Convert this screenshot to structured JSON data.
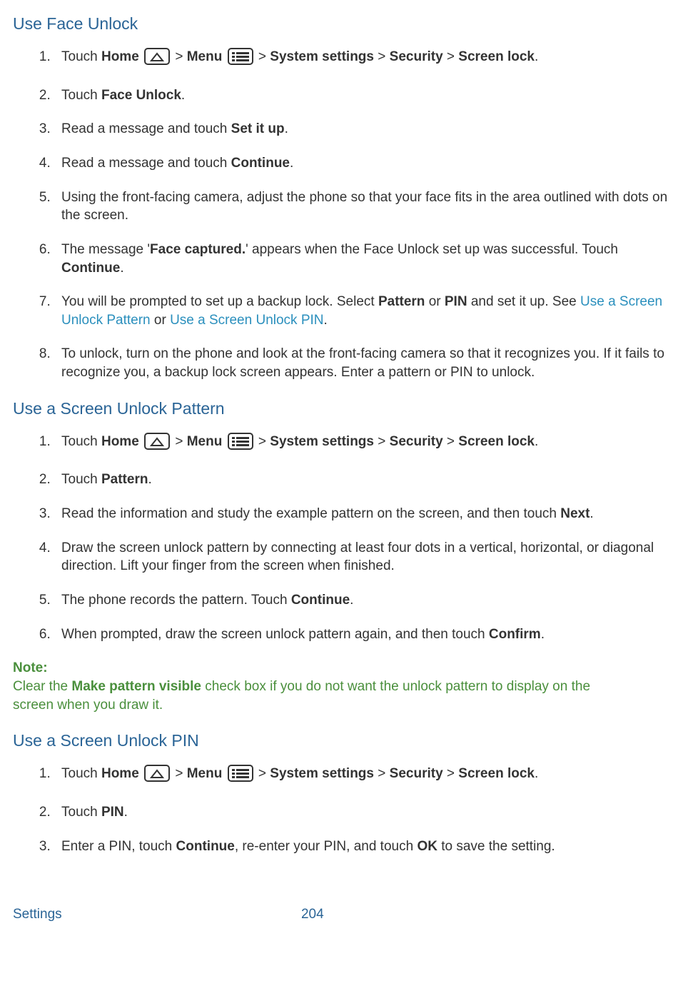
{
  "section1": {
    "heading": "Use Face Unlock",
    "steps": {
      "s1": {
        "touch": "Touch ",
        "home": "Home",
        "gt1": " > ",
        "menu": "Menu",
        "gt2": " > ",
        "syssettings": "System settings",
        "gt3": " > ",
        "security": "Security",
        "gt4": " > ",
        "screenlock": "Screen lock",
        "period": "."
      },
      "s2": {
        "pre": "Touch ",
        "bold": "Face Unlock",
        "post": "."
      },
      "s3": {
        "pre": "Read a message and touch ",
        "bold": "Set it up",
        "post": "."
      },
      "s4": {
        "pre": "Read a message and touch ",
        "bold": "Continue",
        "post": "."
      },
      "s5": "Using the front-facing camera, adjust the phone so that your face fits in the area outlined with dots on the screen.",
      "s6": {
        "pre": "The message '",
        "bold1": "Face captured.",
        "mid": "' appears when the Face Unlock set up was successful. Touch ",
        "bold2": "Continue",
        "post": "."
      },
      "s7": {
        "pre": "You will be prompted to set up a backup lock. Select ",
        "bold1": "Pattern",
        "mid1": " or ",
        "bold2": "PIN",
        "mid2": " and set it up. See ",
        "link1": "Use a Screen Unlock Pattern",
        "mid3": " or ",
        "link2": "Use a Screen Unlock PIN",
        "post": "."
      },
      "s8": "To unlock, turn on the phone and look at the front-facing camera so that it recognizes you. If it fails to recognize you, a backup lock screen appears. Enter a pattern or PIN to unlock."
    }
  },
  "section2": {
    "heading": "Use a Screen Unlock Pattern",
    "steps": {
      "s1": {
        "touch": "Touch ",
        "home": "Home",
        "gt1": " > ",
        "menu": "Menu",
        "gt2": " > ",
        "syssettings": "System settings",
        "gt3": " > ",
        "security": "Security",
        "gt4": " > ",
        "screenlock": "Screen lock",
        "period": "."
      },
      "s2": {
        "pre": "Touch ",
        "bold": "Pattern",
        "post": "."
      },
      "s3": {
        "pre": "Read the information and study the example pattern on the screen, and then touch ",
        "bold": "Next",
        "post": "."
      },
      "s4": "Draw the screen unlock pattern by connecting at least four dots in a vertical, horizontal, or diagonal direction. Lift your finger from the screen when finished.",
      "s5": {
        "pre": "The phone records the pattern. Touch ",
        "bold": "Continue",
        "post": "."
      },
      "s6": {
        "pre": "When prompted, draw the screen unlock pattern again, and then touch ",
        "bold": "Confirm",
        "post": "."
      }
    },
    "note": {
      "label": "Note:",
      "pre": "Clear the ",
      "bold": "Make pattern visible",
      "post": " check box if you do not want the unlock pattern to display on the screen when you draw it."
    }
  },
  "section3": {
    "heading": "Use a Screen Unlock PIN",
    "steps": {
      "s1": {
        "touch": "Touch ",
        "home": "Home",
        "gt1": " > ",
        "menu": "Menu",
        "gt2": " > ",
        "syssettings": "System settings",
        "gt3": " > ",
        "security": "Security",
        "gt4": " > ",
        "screenlock": "Screen lock",
        "period": "."
      },
      "s2": {
        "pre": "Touch ",
        "bold": "PIN",
        "post": "."
      },
      "s3": {
        "pre": "Enter a PIN, touch ",
        "bold1": "Continue",
        "mid": ", re-enter your PIN, and touch ",
        "bold2": "OK",
        "post": " to save the setting."
      }
    }
  },
  "footer": {
    "section": "Settings",
    "page": "204"
  }
}
